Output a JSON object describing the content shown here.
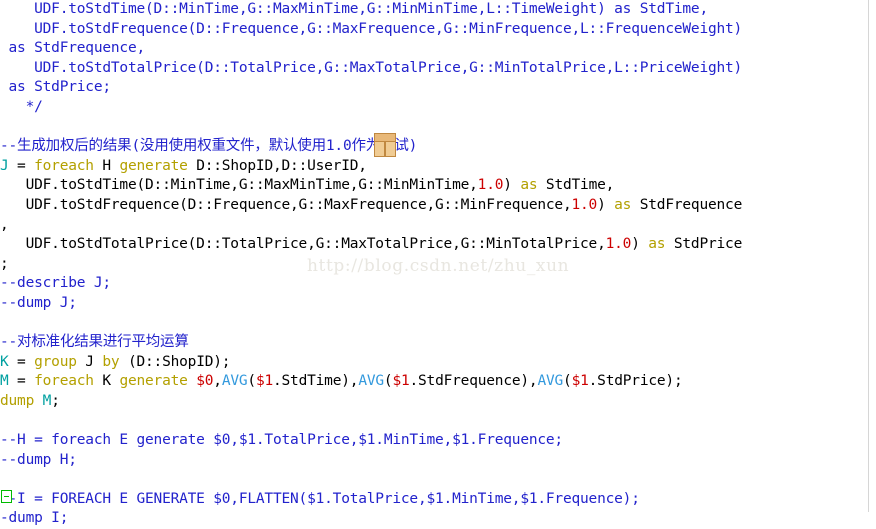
{
  "editor": {
    "language": "Pig Latin",
    "colors": {
      "background": "#ffffff",
      "comment": "#2222cc",
      "keyword": "#b3a000",
      "relation_variable": "#00a0a0",
      "number": "#cc0000",
      "function": "#3399dd",
      "plain_text": "#000000",
      "fold_marker": "#00bb00",
      "watermark": "#e8e6e0"
    },
    "watermark": "http://blog.csdn.net/zhu_xun",
    "cursor_icon": "package-box-cursor-icon",
    "fold_marker": "collapse-fold-marker"
  },
  "code_lines": [
    {
      "id": "line-1",
      "tokens": [
        {
          "text": "    UDF.toStdTime(D::MinTime,G::MaxMinTime,G::MinMinTime,L::TimeWeight) as StdTime,",
          "type": "comment"
        }
      ]
    },
    {
      "id": "line-2",
      "tokens": [
        {
          "text": "    UDF.toStdFrequence(D::Frequence,G::MaxFrequence,G::MinFrequence,L::FrequenceWeight)",
          "type": "comment"
        }
      ]
    },
    {
      "id": "line-3",
      "tokens": [
        {
          "text": " as StdFrequence,",
          "type": "comment"
        }
      ]
    },
    {
      "id": "line-4",
      "tokens": [
        {
          "text": "    UDF.toStdTotalPrice(D::TotalPrice,G::MaxTotalPrice,G::MinTotalPrice,L::PriceWeight)",
          "type": "comment"
        }
      ]
    },
    {
      "id": "line-5",
      "tokens": [
        {
          "text": " as StdPrice;",
          "type": "comment"
        }
      ]
    },
    {
      "id": "line-6",
      "tokens": [
        {
          "text": "   */",
          "type": "comment"
        }
      ]
    },
    {
      "id": "line-7",
      "tokens": []
    },
    {
      "id": "line-8",
      "tokens": [
        {
          "text": "--生成加权后的结果(没用使用权重文件，默认使用1.0作为测试)",
          "type": "comment"
        }
      ]
    },
    {
      "id": "line-9",
      "tokens": [
        {
          "text": "J",
          "type": "variable"
        },
        {
          "text": " = ",
          "type": "plain"
        },
        {
          "text": "foreach",
          "type": "keyword"
        },
        {
          "text": " H ",
          "type": "plain"
        },
        {
          "text": "generate",
          "type": "keyword"
        },
        {
          "text": " D::ShopID,D::UserID,",
          "type": "plain"
        }
      ]
    },
    {
      "id": "line-10",
      "tokens": [
        {
          "text": "   UDF.toStdTime(D::MinTime,G::MaxMinTime,G::MinMinTime,",
          "type": "plain"
        },
        {
          "text": "1.0",
          "type": "number"
        },
        {
          "text": ") ",
          "type": "plain"
        },
        {
          "text": "as",
          "type": "keyword"
        },
        {
          "text": " StdTime,",
          "type": "plain"
        }
      ]
    },
    {
      "id": "line-11",
      "tokens": [
        {
          "text": "   UDF.toStdFrequence(D::Frequence,G::MaxFrequence,G::MinFrequence,",
          "type": "plain"
        },
        {
          "text": "1.0",
          "type": "number"
        },
        {
          "text": ") ",
          "type": "plain"
        },
        {
          "text": "as",
          "type": "keyword"
        },
        {
          "text": " StdFrequence",
          "type": "plain"
        }
      ]
    },
    {
      "id": "line-12",
      "tokens": [
        {
          "text": ",",
          "type": "plain"
        }
      ]
    },
    {
      "id": "line-13",
      "tokens": [
        {
          "text": "   UDF.toStdTotalPrice(D::TotalPrice,G::MaxTotalPrice,G::MinTotalPrice,",
          "type": "plain"
        },
        {
          "text": "1.0",
          "type": "number"
        },
        {
          "text": ") ",
          "type": "plain"
        },
        {
          "text": "as",
          "type": "keyword"
        },
        {
          "text": " StdPrice",
          "type": "plain"
        }
      ]
    },
    {
      "id": "line-14",
      "tokens": [
        {
          "text": ";",
          "type": "plain"
        }
      ]
    },
    {
      "id": "line-15",
      "tokens": [
        {
          "text": "--describe J;",
          "type": "comment"
        }
      ]
    },
    {
      "id": "line-16",
      "tokens": [
        {
          "text": "--dump J;",
          "type": "comment"
        }
      ]
    },
    {
      "id": "line-17",
      "tokens": []
    },
    {
      "id": "line-18",
      "tokens": [
        {
          "text": "--对标准化结果进行平均运算",
          "type": "comment"
        }
      ]
    },
    {
      "id": "line-19",
      "tokens": [
        {
          "text": "K",
          "type": "variable"
        },
        {
          "text": " = ",
          "type": "plain"
        },
        {
          "text": "group",
          "type": "keyword"
        },
        {
          "text": " J ",
          "type": "plain"
        },
        {
          "text": "by",
          "type": "keyword"
        },
        {
          "text": " (D::ShopID);",
          "type": "plain"
        }
      ]
    },
    {
      "id": "line-20",
      "tokens": [
        {
          "text": "M",
          "type": "variable"
        },
        {
          "text": " = ",
          "type": "plain"
        },
        {
          "text": "foreach",
          "type": "keyword"
        },
        {
          "text": " K ",
          "type": "plain"
        },
        {
          "text": "generate",
          "type": "keyword"
        },
        {
          "text": " ",
          "type": "plain"
        },
        {
          "text": "$0",
          "type": "number"
        },
        {
          "text": ",",
          "type": "plain"
        },
        {
          "text": "AVG",
          "type": "function"
        },
        {
          "text": "(",
          "type": "plain"
        },
        {
          "text": "$1",
          "type": "number"
        },
        {
          "text": ".StdTime),",
          "type": "plain"
        },
        {
          "text": "AVG",
          "type": "function"
        },
        {
          "text": "(",
          "type": "plain"
        },
        {
          "text": "$1",
          "type": "number"
        },
        {
          "text": ".StdFrequence),",
          "type": "plain"
        },
        {
          "text": "AVG",
          "type": "function"
        },
        {
          "text": "(",
          "type": "plain"
        },
        {
          "text": "$1",
          "type": "number"
        },
        {
          "text": ".StdPrice);",
          "type": "plain"
        }
      ]
    },
    {
      "id": "line-21",
      "tokens": [
        {
          "text": "dump",
          "type": "keyword"
        },
        {
          "text": " ",
          "type": "plain"
        },
        {
          "text": "M",
          "type": "variable"
        },
        {
          "text": ";",
          "type": "plain"
        }
      ]
    },
    {
      "id": "line-22",
      "tokens": []
    },
    {
      "id": "line-23",
      "tokens": [
        {
          "text": "--H = foreach E generate $0,$1.TotalPrice,$1.MinTime,$1.Frequence;",
          "type": "comment"
        }
      ]
    },
    {
      "id": "line-24",
      "tokens": [
        {
          "text": "--dump H;",
          "type": "comment"
        }
      ]
    },
    {
      "id": "line-25",
      "tokens": []
    },
    {
      "id": "line-26",
      "tokens": [
        {
          "text": "--I = FOREACH E GENERATE $0,FLATTEN($1.TotalPrice,$1.MinTime,$1.Frequence);",
          "type": "comment"
        }
      ]
    },
    {
      "id": "line-27",
      "tokens": [
        {
          "text": "-dump I;",
          "type": "comment"
        }
      ]
    }
  ]
}
